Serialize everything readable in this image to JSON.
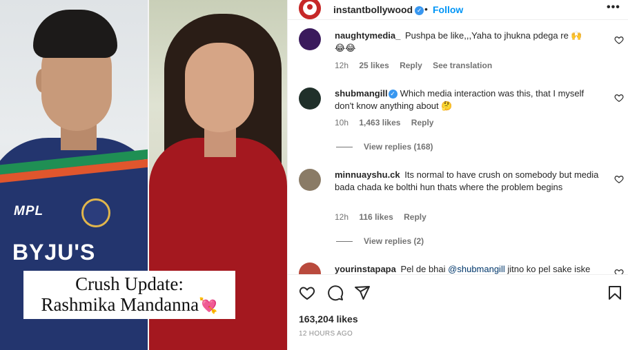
{
  "post": {
    "author": "instantbollywood",
    "separator": "•",
    "follow_label": "Follow",
    "more_label": "•••",
    "image_caption_line1": "Crush Update:",
    "image_caption_line2": "Rashmika Mandanna",
    "jersey_sponsor_1": "MPL",
    "jersey_sponsor_2": "BYJU'S",
    "likes": "163,204 likes",
    "time_ago": "12 HOURS AGO"
  },
  "comments": [
    {
      "user": "naughtymedia_",
      "verified": false,
      "text": "Pushpa be like,,,Yaha to jhukna pdega re 🙌",
      "text_line2": "😂😂",
      "time": "12h",
      "likes": "25 likes",
      "reply": "Reply",
      "translate": "See translation",
      "avatar_color": "#3a1a5c"
    },
    {
      "user": "shubmangill",
      "verified": true,
      "text": "Which media interaction was this, that I myself don't know anything about 🤔",
      "time": "10h",
      "likes": "1,463 likes",
      "reply": "Reply",
      "view_replies": "View replies (168)",
      "avatar_color": "#20302a"
    },
    {
      "user": "minnuayshu.ck",
      "verified": false,
      "text": "Its normal to have crush on somebody but media bada chada ke bolthi hun thats where the problem begins",
      "time": "12h",
      "likes": "116 likes",
      "reply": "Reply",
      "view_replies": "View replies (2)",
      "avatar_color": "#8a7b66"
    },
    {
      "user": "yourinstapapa",
      "verified": false,
      "text_before": "Pel de bhai ",
      "mention": "@shubmangill",
      "text_after": " jitno ko pel sake iske",
      "avatar_color": "#b94a3d"
    }
  ],
  "icons": {
    "like": "heart-outline-icon",
    "comment": "speech-bubble-icon",
    "share": "paper-plane-icon",
    "save": "bookmark-icon",
    "verified": "verified-badge-icon"
  },
  "colors": {
    "follow": "#0095f6",
    "verified": "#3897f0",
    "muted": "#737373"
  }
}
